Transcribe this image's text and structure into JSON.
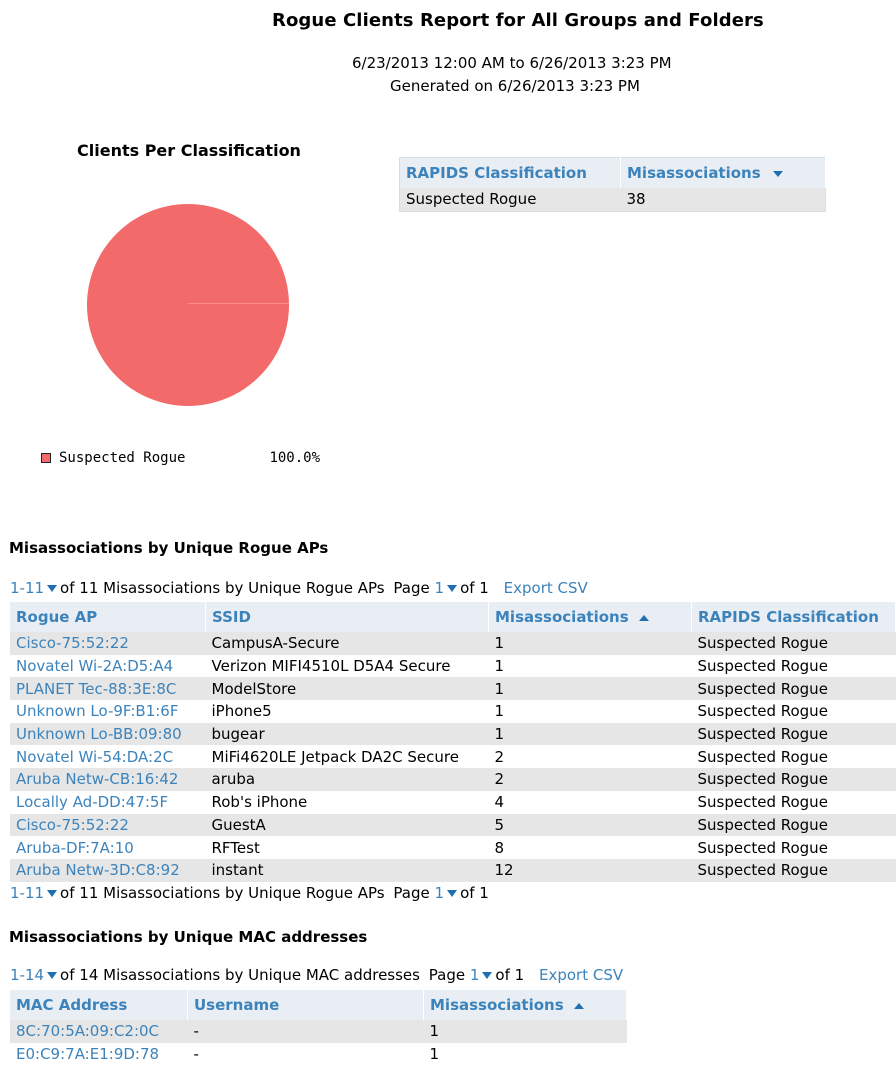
{
  "report": {
    "title": "Rogue Clients Report for All Groups and Folders",
    "date_range": "6/23/2013 12:00 AM to 6/26/2013 3:23 PM",
    "generated": "Generated on 6/26/2013 3:23 PM"
  },
  "chart": {
    "title": "Clients Per Classification",
    "legend_label": "Suspected Rogue",
    "legend_pct": "100.0%",
    "slice_color": "#f36a6a"
  },
  "chart_data": {
    "type": "pie",
    "title": "Clients Per Classification",
    "labels": [
      "Suspected Rogue"
    ],
    "values": [
      100.0
    ]
  },
  "classification_table": {
    "headers": [
      "RAPIDS Classification",
      "Misassociations"
    ],
    "rows": [
      [
        "Suspected Rogue",
        "38"
      ]
    ]
  },
  "rogue_aps": {
    "section_title": "Misassociations by Unique Rogue APs",
    "pager_range": "1-11",
    "pager_text": "of 11 Misassociations by Unique Rogue APs",
    "page_label": "Page",
    "page_num": "1",
    "page_of": "of 1",
    "export": "Export CSV",
    "headers": [
      "Rogue AP",
      "SSID",
      "Misassociations",
      "RAPIDS Classification"
    ],
    "rows": [
      [
        "Cisco-75:52:22",
        "CampusA-Secure",
        "1",
        "Suspected Rogue"
      ],
      [
        "Novatel Wi-2A:D5:A4",
        "Verizon MIFI4510L D5A4 Secure",
        "1",
        "Suspected Rogue"
      ],
      [
        "PLANET Tec-88:3E:8C",
        "ModelStore",
        "1",
        "Suspected Rogue"
      ],
      [
        "Unknown Lo-9F:B1:6F",
        "iPhone5",
        "1",
        "Suspected Rogue"
      ],
      [
        "Unknown Lo-BB:09:80",
        "bugear",
        "1",
        "Suspected Rogue"
      ],
      [
        "Novatel Wi-54:DA:2C",
        "MiFi4620LE Jetpack DA2C Secure",
        "2",
        "Suspected Rogue"
      ],
      [
        "Aruba Netw-CB:16:42",
        "aruba",
        "2",
        "Suspected Rogue"
      ],
      [
        "Locally Ad-DD:47:5F",
        "Rob's iPhone",
        "4",
        "Suspected Rogue"
      ],
      [
        "Cisco-75:52:22",
        "GuestA",
        "5",
        "Suspected Rogue"
      ],
      [
        "Aruba-DF:7A:10",
        "RFTest",
        "8",
        "Suspected Rogue"
      ],
      [
        "Aruba Netw-3D:C8:92",
        "instant",
        "12",
        "Suspected Rogue"
      ]
    ]
  },
  "mac_addresses": {
    "section_title": "Misassociations by Unique MAC addresses",
    "pager_range": "1-14",
    "pager_text": "of 14 Misassociations by Unique MAC addresses",
    "page_label": "Page",
    "page_num": "1",
    "page_of": "of 1",
    "export": "Export CSV",
    "headers": [
      "MAC Address",
      "Username",
      "Misassociations"
    ],
    "rows": [
      [
        "8C:70:5A:09:C2:0C",
        "-",
        "1"
      ],
      [
        "E0:C9:7A:E1:9D:78",
        "-",
        "1"
      ]
    ]
  }
}
